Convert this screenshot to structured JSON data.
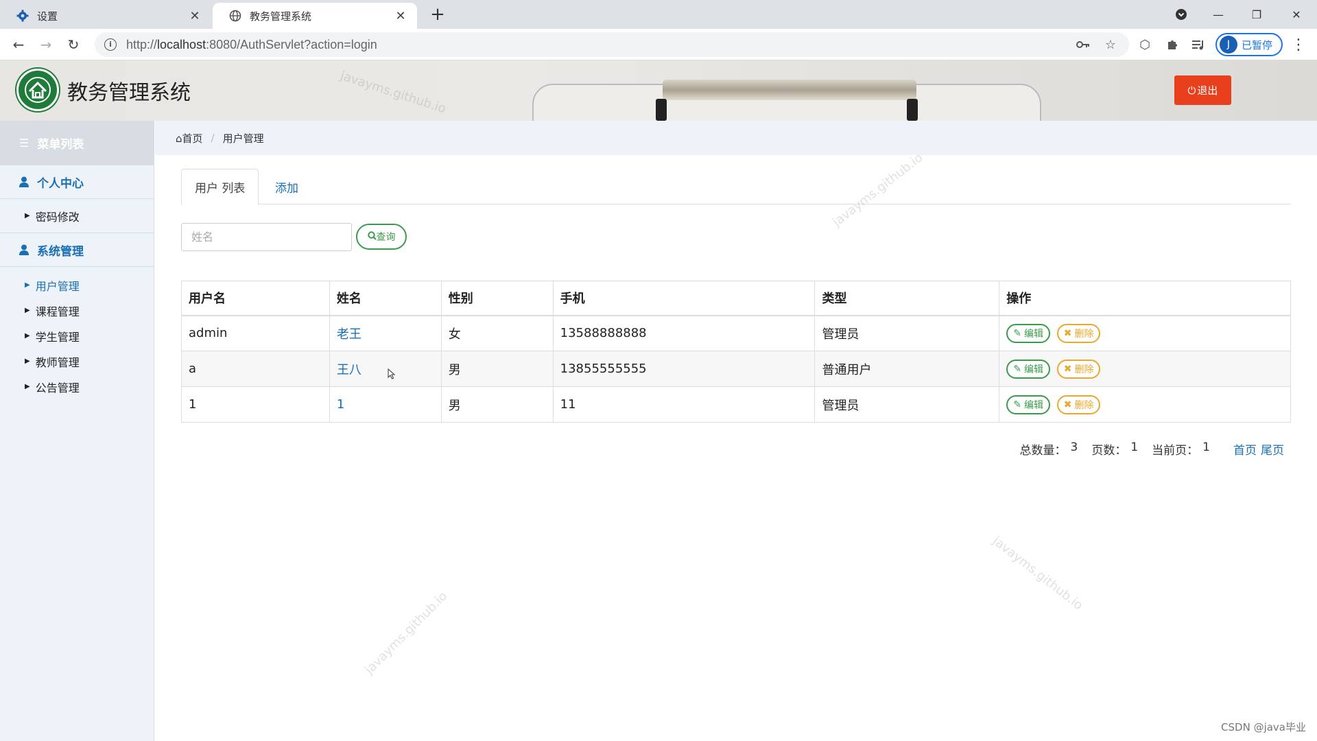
{
  "browser": {
    "tabs": [
      {
        "label": "设置",
        "icon": "gear-icon"
      },
      {
        "label": "教务管理系统",
        "icon": "globe-icon"
      }
    ],
    "url_protocol": "http://",
    "url_host": "localhost",
    "url_rest": ":8080/AuthServlet?action=login",
    "profile_initial": "J",
    "profile_label": "已暂停"
  },
  "header": {
    "title": "教务管理系统",
    "logout_label": "退出"
  },
  "sidebar": {
    "heading": "菜单列表",
    "groups": [
      {
        "label": "个人中心",
        "items": [
          {
            "label": "密码修改"
          }
        ]
      },
      {
        "label": "系统管理",
        "items": [
          {
            "label": "用户管理",
            "active": true
          },
          {
            "label": "课程管理"
          },
          {
            "label": "学生管理"
          },
          {
            "label": "教师管理"
          },
          {
            "label": "公告管理"
          }
        ]
      }
    ]
  },
  "breadcrumb": {
    "home": "首页",
    "current": "用户管理"
  },
  "tabs": [
    {
      "label": "用户 列表"
    },
    {
      "label": "添加"
    }
  ],
  "search": {
    "placeholder": "姓名",
    "button_label": "查询"
  },
  "table": {
    "columns": [
      "用户名",
      "姓名",
      "性别",
      "手机",
      "类型",
      "操作"
    ],
    "rows": [
      {
        "username": "admin",
        "name": "老王",
        "gender": "女",
        "phone": "13588888888",
        "type": "管理员"
      },
      {
        "username": "a",
        "name": "王八",
        "gender": "男",
        "phone": "13855555555",
        "type": "普通用户"
      },
      {
        "username": "1",
        "name": "1",
        "gender": "男",
        "phone": "11",
        "type": "管理员"
      }
    ],
    "edit_label": "编辑",
    "delete_label": "删除"
  },
  "pager": {
    "total_label": "总数量：",
    "total": "3",
    "pages_label": "页数：",
    "pages": "1",
    "current_label": "当前页：",
    "current": "1",
    "first": "首页",
    "last": "尾页"
  },
  "watermark": "javayms.github.io",
  "footer_credit": "CSDN @java毕业",
  "colors": {
    "accent": "#1a6fb4",
    "logout": "#e8401c",
    "edit": "#3a9b4c",
    "delete": "#e8a92c"
  }
}
